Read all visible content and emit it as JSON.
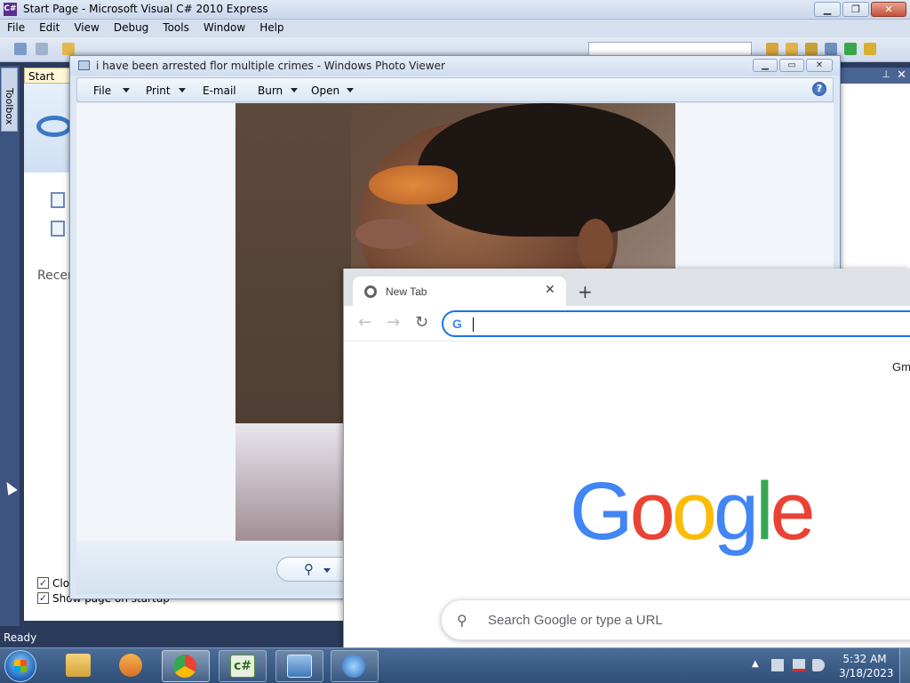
{
  "vs": {
    "title": "Start Page - Microsoft Visual C# 2010 Express",
    "menu": [
      "File",
      "Edit",
      "View",
      "Debug",
      "Tools",
      "Window",
      "Help"
    ],
    "toolbox_label": "Toolbox",
    "start_tab": "Start Pag",
    "recent_label": "Recen",
    "close_after_label": "Clo",
    "show_startup_label": "Show page on startup",
    "status": "Ready"
  },
  "photo_viewer": {
    "title": "i have been arrested flor multiple crimes - Windows Photo Viewer",
    "menu": [
      "File",
      "Print",
      "E-mail",
      "Burn",
      "Open"
    ],
    "help": "?"
  },
  "chrome": {
    "tab_title": "New Tab",
    "tab_close": "✕",
    "new_tab": "+",
    "gmail_link": "Gm",
    "search_placeholder": "Search Google or type a URL",
    "logo_letters": [
      "G",
      "o",
      "o",
      "g",
      "l",
      "e"
    ]
  },
  "taskbar": {
    "time": "5:32 AM",
    "date": "3/18/2023",
    "csharp_label": "c#"
  }
}
